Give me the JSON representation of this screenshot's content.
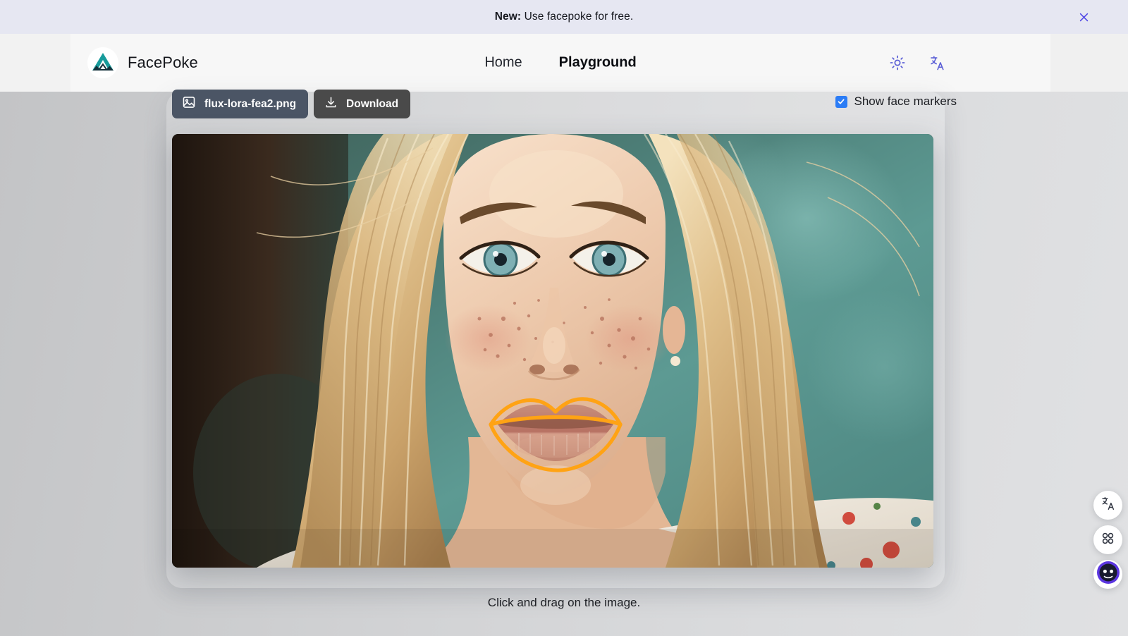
{
  "banner": {
    "label_bold": "New:",
    "label_rest": " Use facepoke for free.",
    "close_icon": "close-icon"
  },
  "header": {
    "brand": "FacePoke",
    "logo_icon": "mountain-logo-icon",
    "nav": [
      {
        "label": "Home",
        "active": false
      },
      {
        "label": "Playground",
        "active": true
      }
    ],
    "icons": [
      {
        "name": "sun-icon",
        "title": "Light mode"
      },
      {
        "name": "translate-icon",
        "title": "Language"
      }
    ]
  },
  "toolbar": {
    "file_button": {
      "label": "flux-lora-fea2.png",
      "icon": "image-icon",
      "color": "#4b5565"
    },
    "download_button": {
      "label": "Download",
      "icon": "download-icon",
      "color": "#4a4a4a"
    },
    "markers_checkbox": {
      "label": "Show face markers",
      "checked": true,
      "accent": "#2b7cf6"
    }
  },
  "canvas": {
    "hint": "Click and drag on the image.",
    "image_alt": "Portrait of a blonde woman with freckles and blue-green eyes against a teal background",
    "marker_color": "#ffa314",
    "marker_region": "mouth"
  },
  "floating": [
    {
      "name": "translate-fab",
      "icon": "translate-icon"
    },
    {
      "name": "apps-fab",
      "icon": "grid-apps-icon"
    },
    {
      "name": "assistant-fab",
      "icon": "assistant-avatar-icon"
    }
  ]
}
